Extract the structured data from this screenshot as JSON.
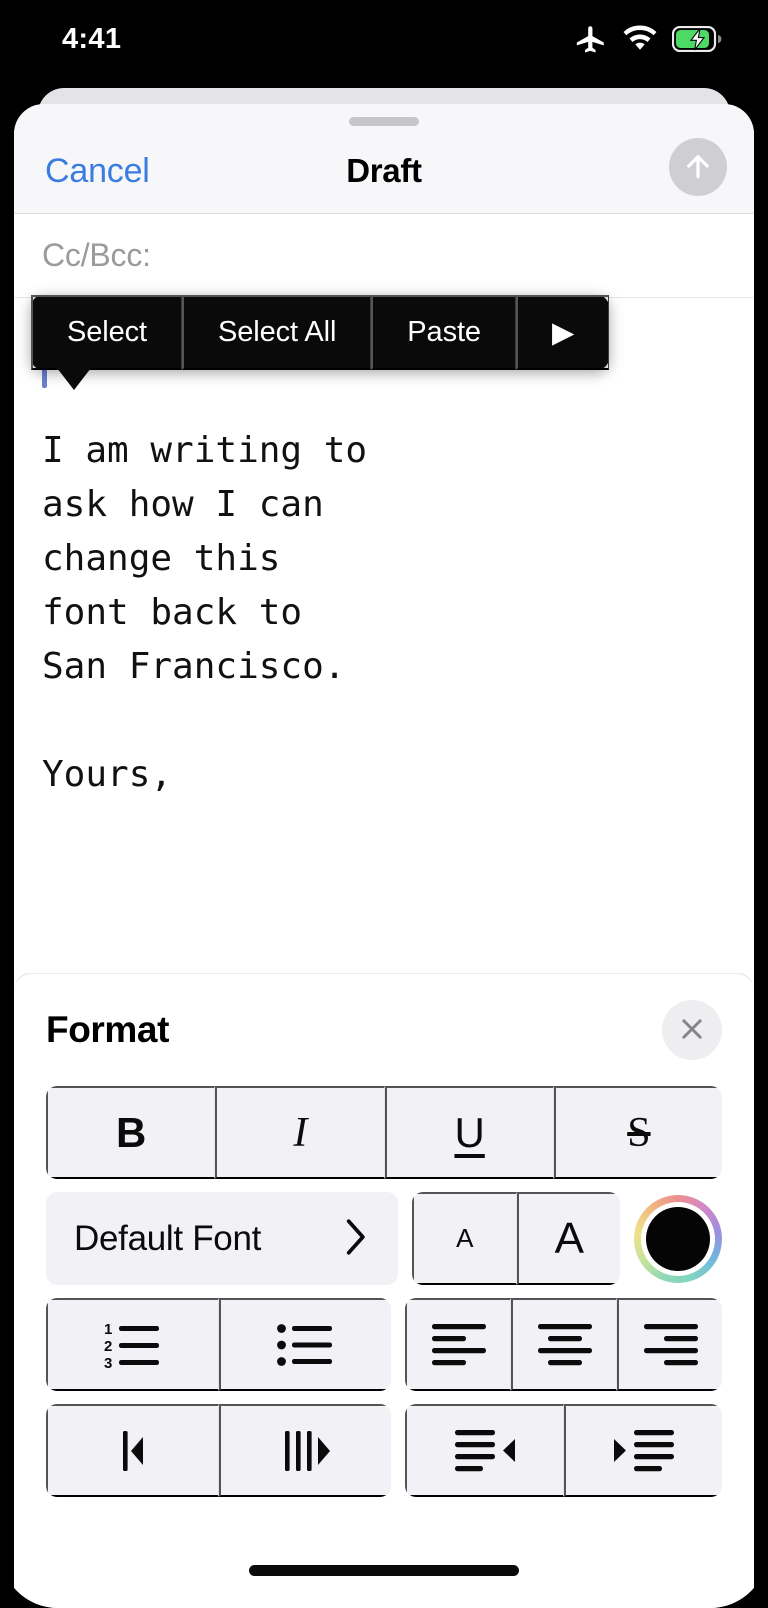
{
  "status_bar": {
    "time": "4:41",
    "icons": [
      "airplane-mode-icon",
      "wifi-icon",
      "battery-charging-icon"
    ],
    "battery_color": "#4cd964"
  },
  "sheet": {
    "cancel_label": "Cancel",
    "title": "Draft",
    "send_icon": "send-arrow-up-icon",
    "send_enabled": false
  },
  "compose": {
    "cc_bcc_label": "Cc/Bcc:",
    "body_text": "I am writing to\nask how I can\nchange this\nfont back to\nSan Francisco.\n\nYours,",
    "caret_color": "#6a7fd4"
  },
  "edit_menu": {
    "items": [
      {
        "label": "Select"
      },
      {
        "label": "Select All"
      },
      {
        "label": "Paste"
      },
      {
        "label": "▶"
      }
    ]
  },
  "format_panel": {
    "title": "Format",
    "close_icon": "close-x-icon",
    "style_row": [
      {
        "name": "bold-button",
        "label": "B"
      },
      {
        "name": "italic-button",
        "label": "I"
      },
      {
        "name": "underline-button",
        "label": "U"
      },
      {
        "name": "strikethrough-button",
        "label": "S"
      }
    ],
    "font_picker": {
      "label": "Default Font",
      "chevron_icon": "chevron-right-icon"
    },
    "size_row": [
      {
        "name": "decrease-font-size-button",
        "label": "A"
      },
      {
        "name": "increase-font-size-button",
        "label": "A"
      }
    ],
    "color_button": {
      "name": "text-color-button",
      "selected_color": "#050505"
    },
    "list_row": [
      {
        "name": "numbered-list-button",
        "icon": "numbered-list-icon"
      },
      {
        "name": "bulleted-list-button",
        "icon": "bulleted-list-icon"
      }
    ],
    "align_row": [
      {
        "name": "align-left-button",
        "icon": "align-left-icon"
      },
      {
        "name": "align-center-button",
        "icon": "align-center-icon"
      },
      {
        "name": "align-right-button",
        "icon": "align-right-icon"
      }
    ],
    "direction_row": [
      {
        "name": "text-direction-ltr-button",
        "icon": "text-direction-left-icon"
      },
      {
        "name": "text-direction-rtl-button",
        "icon": "text-direction-right-icon"
      }
    ],
    "indent_row": [
      {
        "name": "outdent-button",
        "icon": "outdent-icon"
      },
      {
        "name": "indent-button",
        "icon": "indent-icon"
      }
    ]
  },
  "home_indicator": "home-indicator"
}
